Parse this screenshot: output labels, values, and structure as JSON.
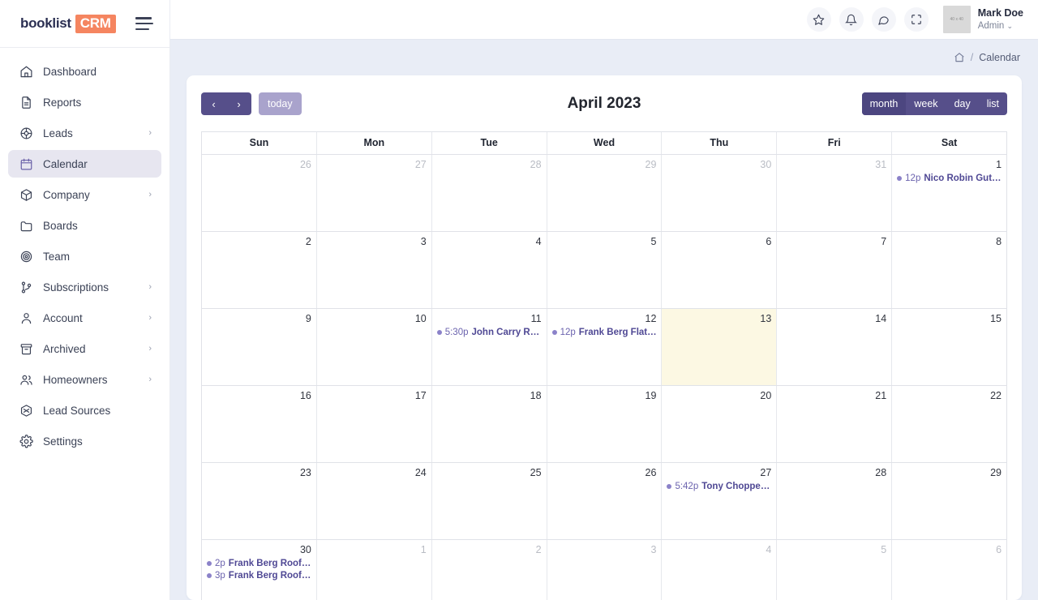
{
  "brand": {
    "word": "booklist",
    "badge": "CRM",
    "badge_color": "#f58560",
    "word_color": "#2b2f52"
  },
  "sidebar": {
    "menu_icon": "hamburger-icon",
    "items": [
      {
        "label": "Dashboard",
        "icon": "home-icon",
        "chevron": "",
        "active": false
      },
      {
        "label": "Reports",
        "icon": "document-icon",
        "chevron": "",
        "active": false
      },
      {
        "label": "Leads",
        "icon": "target-icon",
        "chevron": "›",
        "active": false
      },
      {
        "label": "Calendar",
        "icon": "calendar-icon",
        "chevron": "",
        "active": true
      },
      {
        "label": "Company",
        "icon": "box-icon",
        "chevron": "›",
        "active": false
      },
      {
        "label": "Boards",
        "icon": "folder-icon",
        "chevron": "",
        "active": false
      },
      {
        "label": "Team",
        "icon": "circles-icon",
        "chevron": "",
        "active": false
      },
      {
        "label": "Subscriptions",
        "icon": "branch-icon",
        "chevron": "›",
        "active": false
      },
      {
        "label": "Account",
        "icon": "person-icon",
        "chevron": "›",
        "active": false
      },
      {
        "label": "Archived",
        "icon": "archive-icon",
        "chevron": "›",
        "active": false
      },
      {
        "label": "Homeowners",
        "icon": "people-icon",
        "chevron": "›",
        "active": false
      },
      {
        "label": "Lead Sources",
        "icon": "hexagon-icon",
        "chevron": "",
        "active": false
      },
      {
        "label": "Settings",
        "icon": "gear-icon",
        "chevron": "",
        "active": false
      }
    ]
  },
  "topbar": {
    "actions": [
      {
        "icon": "star-icon"
      },
      {
        "icon": "bell-icon"
      },
      {
        "icon": "chat-icon"
      },
      {
        "icon": "fullscreen-icon"
      }
    ],
    "avatar_placeholder": "40 x 40",
    "user_name": "Mark Doe",
    "user_role": "Admin",
    "user_role_caret": "⌄"
  },
  "breadcrumb": {
    "home_icon": "home-icon",
    "separator": "/",
    "current": "Calendar"
  },
  "calendar": {
    "prev_label": "‹",
    "next_label": "›",
    "today_label": "today",
    "title": "April 2023",
    "views": [
      {
        "label": "month",
        "selected": true
      },
      {
        "label": "week",
        "selected": false
      },
      {
        "label": "day",
        "selected": false
      },
      {
        "label": "list",
        "selected": false
      }
    ],
    "weekdays": [
      "Sun",
      "Mon",
      "Tue",
      "Wed",
      "Thu",
      "Fri",
      "Sat"
    ],
    "weeks": [
      {
        "days": [
          {
            "num": "26",
            "other": true,
            "today": false,
            "events": []
          },
          {
            "num": "27",
            "other": true,
            "today": false,
            "events": []
          },
          {
            "num": "28",
            "other": true,
            "today": false,
            "events": []
          },
          {
            "num": "29",
            "other": true,
            "today": false,
            "events": []
          },
          {
            "num": "30",
            "other": true,
            "today": false,
            "events": []
          },
          {
            "num": "31",
            "other": true,
            "today": false,
            "events": []
          },
          {
            "num": "1",
            "other": false,
            "today": false,
            "events": [
              {
                "time": "12p",
                "title": "Nico Robin Gutter I…"
              }
            ]
          }
        ]
      },
      {
        "days": [
          {
            "num": "2",
            "other": false,
            "today": false,
            "events": []
          },
          {
            "num": "3",
            "other": false,
            "today": false,
            "events": []
          },
          {
            "num": "4",
            "other": false,
            "today": false,
            "events": []
          },
          {
            "num": "5",
            "other": false,
            "today": false,
            "events": []
          },
          {
            "num": "6",
            "other": false,
            "today": false,
            "events": []
          },
          {
            "num": "7",
            "other": false,
            "today": false,
            "events": []
          },
          {
            "num": "8",
            "other": false,
            "today": false,
            "events": []
          }
        ]
      },
      {
        "days": [
          {
            "num": "9",
            "other": false,
            "today": false,
            "events": []
          },
          {
            "num": "10",
            "other": false,
            "today": false,
            "events": []
          },
          {
            "num": "11",
            "other": false,
            "today": false,
            "events": [
              {
                "time": "5:30p",
                "title": "John Carry Roofi…"
              }
            ]
          },
          {
            "num": "12",
            "other": false,
            "today": false,
            "events": [
              {
                "time": "12p",
                "title": "Frank Berg Flat Ro…"
              }
            ]
          },
          {
            "num": "13",
            "other": false,
            "today": true,
            "events": []
          },
          {
            "num": "14",
            "other": false,
            "today": false,
            "events": []
          },
          {
            "num": "15",
            "other": false,
            "today": false,
            "events": []
          }
        ]
      },
      {
        "days": [
          {
            "num": "16",
            "other": false,
            "today": false,
            "events": []
          },
          {
            "num": "17",
            "other": false,
            "today": false,
            "events": []
          },
          {
            "num": "18",
            "other": false,
            "today": false,
            "events": []
          },
          {
            "num": "19",
            "other": false,
            "today": false,
            "events": []
          },
          {
            "num": "20",
            "other": false,
            "today": false,
            "events": []
          },
          {
            "num": "21",
            "other": false,
            "today": false,
            "events": []
          },
          {
            "num": "22",
            "other": false,
            "today": false,
            "events": []
          }
        ]
      },
      {
        "days": [
          {
            "num": "23",
            "other": false,
            "today": false,
            "events": []
          },
          {
            "num": "24",
            "other": false,
            "today": false,
            "events": []
          },
          {
            "num": "25",
            "other": false,
            "today": false,
            "events": []
          },
          {
            "num": "26",
            "other": false,
            "today": false,
            "events": []
          },
          {
            "num": "27",
            "other": false,
            "today": false,
            "events": [
              {
                "time": "5:42p",
                "title": "Tony Chopper Ro…"
              }
            ]
          },
          {
            "num": "28",
            "other": false,
            "today": false,
            "events": []
          },
          {
            "num": "29",
            "other": false,
            "today": false,
            "events": []
          }
        ]
      },
      {
        "days": [
          {
            "num": "30",
            "other": false,
            "today": false,
            "events": [
              {
                "time": "2p",
                "title": "Frank Berg Roofing …"
              },
              {
                "time": "3p",
                "title": "Frank Berg Roofing …"
              }
            ]
          },
          {
            "num": "1",
            "other": true,
            "today": false,
            "events": []
          },
          {
            "num": "2",
            "other": true,
            "today": false,
            "events": []
          },
          {
            "num": "3",
            "other": true,
            "today": false,
            "events": []
          },
          {
            "num": "4",
            "other": true,
            "today": false,
            "events": []
          },
          {
            "num": "5",
            "other": true,
            "today": false,
            "events": []
          },
          {
            "num": "6",
            "other": true,
            "today": false,
            "events": []
          }
        ]
      }
    ]
  },
  "theme": {
    "accent_purple": "#564f8a",
    "accent_purple_light": "#a9a3cc",
    "brand_orange": "#f58560",
    "page_bg": "#e9edf6",
    "today_bg": "#fcf8e3",
    "event_text": "#4f4894"
  }
}
